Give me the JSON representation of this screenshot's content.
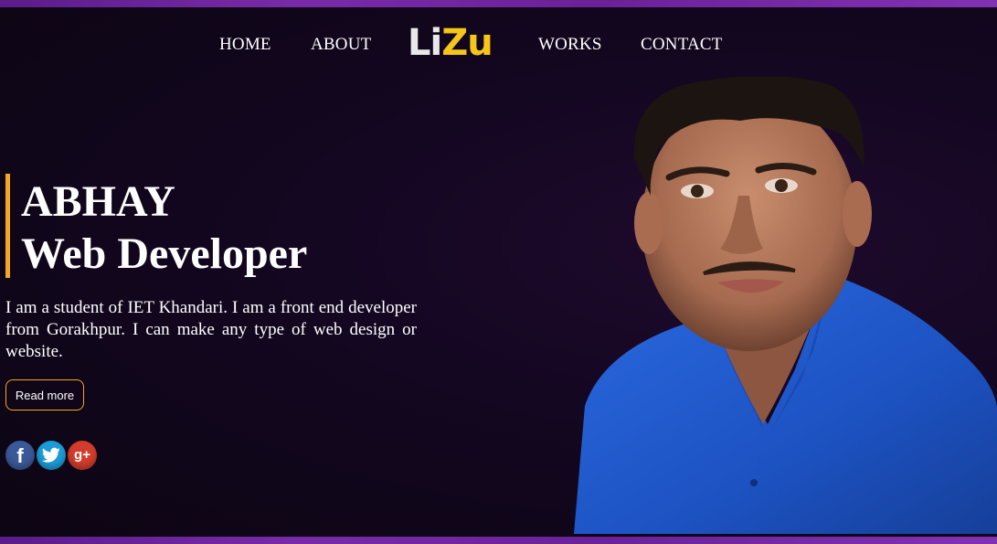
{
  "nav": {
    "home": "HOME",
    "about": "ABOUT",
    "works": "WORKS",
    "contact": "CONTACT"
  },
  "logo": {
    "part1": "Li",
    "part2": "Zu"
  },
  "hero": {
    "name": "ABHAY",
    "role": "Web Developer",
    "description": "I am a student of IET Khandari. I am a front end developer from Gorakhpur. I can make any type of web design or website.",
    "read_more": "Read more"
  },
  "social": [
    {
      "icon": "facebook-icon",
      "glyph": "f",
      "color": "#3b5998"
    },
    {
      "icon": "twitter-icon",
      "glyph": "",
      "color": "#1d9bd7"
    },
    {
      "icon": "google-plus-icon",
      "glyph": "g+",
      "color": "#d23c2c"
    }
  ],
  "colors": {
    "accent": "#f5a623",
    "logo_yellow": "#f5c518",
    "border_purple": "#7a2aa8",
    "background": "#0d0614"
  }
}
